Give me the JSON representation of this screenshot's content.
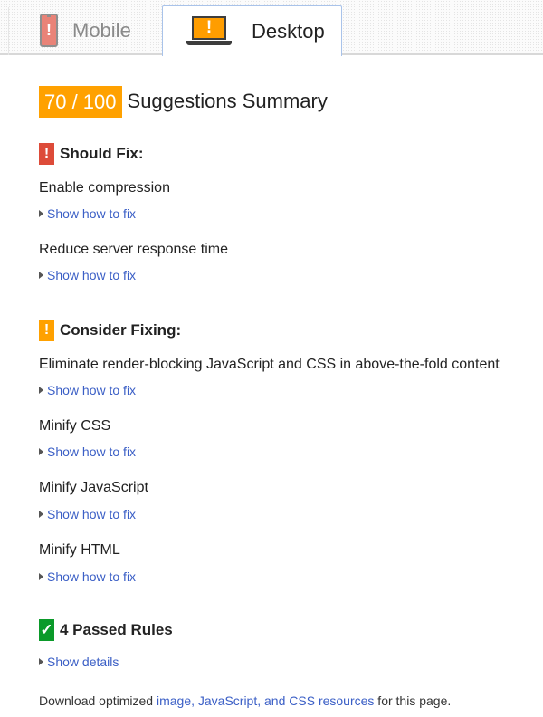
{
  "tabs": [
    {
      "label": "Mobile",
      "icon": "mobile-phone-warning-icon",
      "active": false
    },
    {
      "label": "Desktop",
      "icon": "laptop-warning-icon",
      "active": true
    }
  ],
  "summary": {
    "score": "70 / 100",
    "title": "Suggestions Summary",
    "score_color": "#ffa100"
  },
  "should_fix": {
    "badge": "!",
    "heading": "Should Fix:",
    "color": "#dd4b39",
    "rules": [
      {
        "title": "Enable compression",
        "link": "Show how to fix"
      },
      {
        "title": "Reduce server response time",
        "link": "Show how to fix"
      }
    ]
  },
  "consider_fixing": {
    "badge": "!",
    "heading": "Consider Fixing:",
    "color": "#ffa100",
    "rules": [
      {
        "title": "Eliminate render-blocking JavaScript and CSS in above-the-fold content",
        "link": "Show how to fix"
      },
      {
        "title": "Minify CSS",
        "link": "Show how to fix"
      },
      {
        "title": "Minify JavaScript",
        "link": "Show how to fix"
      },
      {
        "title": "Minify HTML",
        "link": "Show how to fix"
      }
    ]
  },
  "passed": {
    "badge": "✓",
    "heading": "4 Passed Rules",
    "color": "#0b9a2a",
    "link": "Show details"
  },
  "footer": {
    "prefix": "Download optimized ",
    "link": "image, JavaScript, and CSS resources",
    "suffix": " for this page."
  }
}
